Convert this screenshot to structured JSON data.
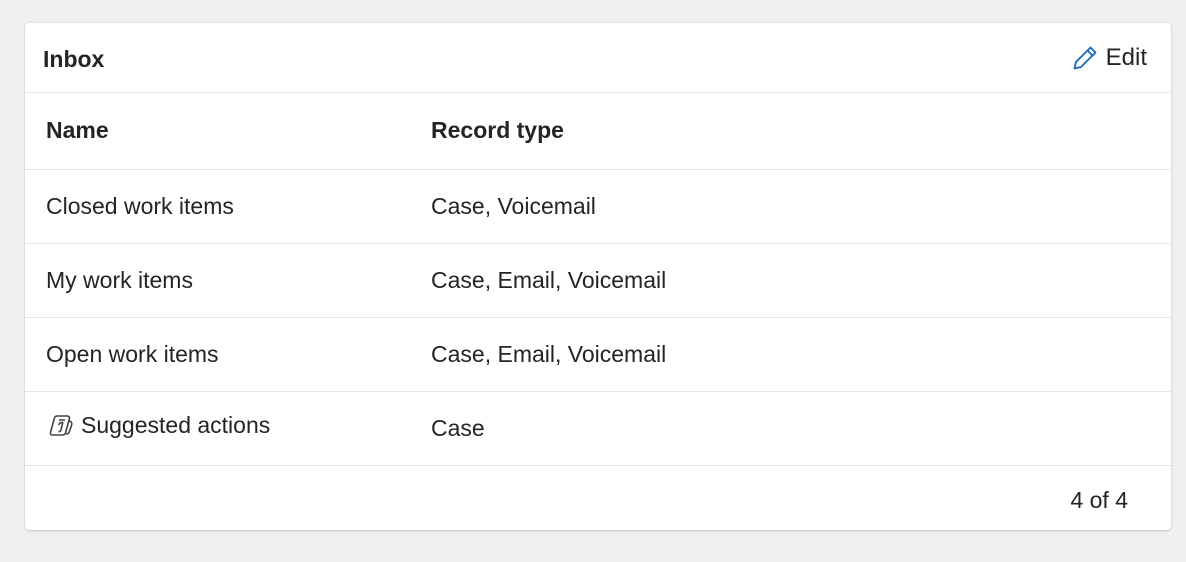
{
  "card": {
    "title": "Inbox",
    "edit_label": "Edit"
  },
  "table": {
    "columns": [
      "Name",
      "Record type"
    ],
    "rows": [
      {
        "name": "Closed work items",
        "record_type": "Case, Voicemail",
        "icon": null
      },
      {
        "name": "My work items",
        "record_type": "Case, Email, Voicemail",
        "icon": null
      },
      {
        "name": "Open work items",
        "record_type": "Case, Email, Voicemail",
        "icon": null
      },
      {
        "name": "Suggested actions",
        "record_type": "Case",
        "icon": "copilot-icon"
      }
    ]
  },
  "footer": {
    "pager": "4 of 4"
  },
  "colors": {
    "accent": "#0f6cbd",
    "background": "#f0f0f0",
    "card": "#ffffff",
    "divider": "#e5e5e5"
  }
}
